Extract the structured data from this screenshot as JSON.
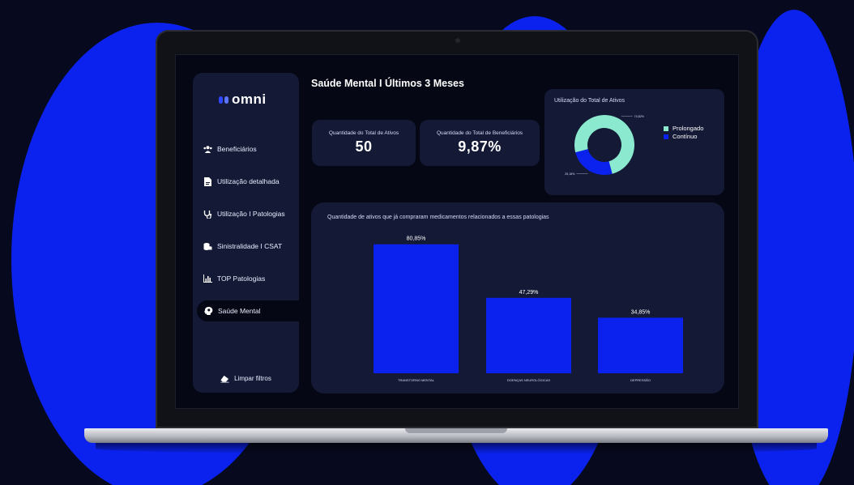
{
  "colors": {
    "background": "#070a1f",
    "blob": "#0b22ef",
    "card": "#141a35",
    "accent_blue": "#0b22ef",
    "accent_mint": "#8be9d0"
  },
  "app": {
    "logo_text": "omni"
  },
  "sidebar": {
    "items": [
      {
        "label": "Beneficiários",
        "icon": "users-icon"
      },
      {
        "label": "Utilização detalhada",
        "icon": "document-icon"
      },
      {
        "label": "Utilização I Patologias",
        "icon": "stethoscope-icon"
      },
      {
        "label": "Sinistralidade I CSAT",
        "icon": "coins-icon"
      },
      {
        "label": "TOP Patologias",
        "icon": "bar-chart-icon"
      },
      {
        "label": "Saúde Mental",
        "icon": "brain-icon",
        "active": true
      }
    ],
    "clear_filters": "Limpar filtros"
  },
  "page": {
    "title": "Saúde Mental I Últimos 3 Meses"
  },
  "kpis": [
    {
      "label": "Quantidade do Total de Ativos",
      "value": "50"
    },
    {
      "label": "Quantidade do Total de Beneficiários",
      "value": "9,87%"
    }
  ],
  "chart_data": [
    {
      "type": "pie",
      "title": "Utilização do Total de Ativos",
      "donut": true,
      "slices": [
        {
          "name": "Prolongado",
          "value": 74.82,
          "label": "74,82%",
          "color": "#8be9d0"
        },
        {
          "name": "Contínuo",
          "value": 25.18,
          "label": "25,18%",
          "color": "#0b22ef"
        }
      ],
      "legend": "right"
    },
    {
      "type": "bar",
      "title": "Quantidade de ativos que já compraram medicamentos relacionados a essas patologias",
      "categories": [
        "TRANSTORNO MENTAL",
        "DOENÇAS NEUROLÓGICAS",
        "DEPRESSÃO"
      ],
      "values": [
        80.85,
        47.29,
        34.85
      ],
      "value_labels": [
        "80,85%",
        "47,29%",
        "34,85%"
      ],
      "ylim": [
        0,
        100
      ],
      "color": "#0b22ef",
      "grid": false
    }
  ]
}
